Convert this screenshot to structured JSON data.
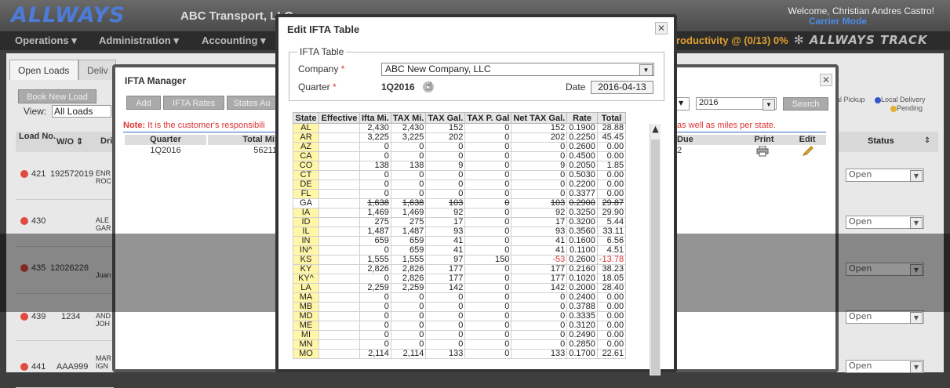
{
  "app": {
    "logo": "ALLWAYS",
    "company": "ABC Transport, LLC",
    "welcome": "Welcome, Christian Andres Castro!",
    "mode": "Carrier Mode",
    "menu": [
      "Operations",
      "Administration",
      "Accounting"
    ],
    "productivity": "roductivity @ (0/13) 0%",
    "track_logo": "ALLWAYS TRACK"
  },
  "background": {
    "tabs": [
      "Open Loads",
      "Deliv"
    ],
    "header": {
      "load_no": "Load No.",
      "wo": "W/O",
      "dr": "Dri",
      "status": "Status"
    },
    "rows": [
      {
        "load": "421",
        "wo": "192572019",
        "name": "ENR ROC",
        "status": "Open"
      },
      {
        "load": "430",
        "wo": "",
        "name": "ALE GAR",
        "status": "Open"
      },
      {
        "load": "435",
        "wo": "12026226",
        "name": "Juan",
        "status": "Open"
      },
      {
        "load": "439",
        "wo": "1234",
        "name": "AND JOH",
        "status": "Open"
      },
      {
        "load": "441",
        "wo": "AAA999",
        "name": "MAR IGN",
        "status": "Open"
      }
    ],
    "legend_pickup": "al Pickup",
    "legend_local": "Local Delivery",
    "legend_pending": "Pending"
  },
  "manager": {
    "title": "IFTA Manager",
    "buttons": {
      "add": "Add",
      "rates": "IFTA Rates",
      "states": "States Au"
    },
    "book_new_load": "Book New Load",
    "view_label": "View:",
    "view_value": "All Loads",
    "note_label": "Note:",
    "note_text": "It is the customer's responsibili",
    "note_suffix": "as well as miles per state.",
    "year": "2016",
    "search": "Search",
    "grid_headers": {
      "quarter": "Quarter",
      "total": "Total Mil",
      "due": "Due",
      "print": "Print",
      "edit": "Edit"
    },
    "grid_row": {
      "quarter": "1Q2016",
      "total": "56211",
      "due": "2"
    }
  },
  "edit_dialog": {
    "title": "Edit IFTA Table",
    "legend": "IFTA Table",
    "company_label": "Company",
    "company_value": "ABC New Company, LLC",
    "quarter_label": "Quarter",
    "quarter_value": "1Q2016",
    "date_label": "Date",
    "date_value": "2016-04-13",
    "columns": [
      "State",
      "Effective",
      "Ifta Mi.",
      "TAX Mi.",
      "TAX Gal.",
      "TAX P. Gal",
      "Net TAX Gal.",
      "Rate",
      "Total"
    ],
    "rows": [
      {
        "state": "AL",
        "eff": "",
        "ifta": "2,430",
        "tax_mi": "2,430",
        "tax_gal": "152",
        "tax_p": "0",
        "net": "152",
        "rate": "0.1900",
        "total": "28.88"
      },
      {
        "state": "AR",
        "eff": "",
        "ifta": "3,225",
        "tax_mi": "3,225",
        "tax_gal": "202",
        "tax_p": "0",
        "net": "202",
        "rate": "0.2250",
        "total": "45.45"
      },
      {
        "state": "AZ",
        "eff": "",
        "ifta": "0",
        "tax_mi": "0",
        "tax_gal": "0",
        "tax_p": "0",
        "net": "0",
        "rate": "0.2600",
        "total": "0.00"
      },
      {
        "state": "CA",
        "eff": "",
        "ifta": "0",
        "tax_mi": "0",
        "tax_gal": "0",
        "tax_p": "0",
        "net": "0",
        "rate": "0.4500",
        "total": "0.00"
      },
      {
        "state": "CO",
        "eff": "",
        "ifta": "138",
        "tax_mi": "138",
        "tax_gal": "9",
        "tax_p": "0",
        "net": "9",
        "rate": "0.2050",
        "total": "1.85"
      },
      {
        "state": "CT",
        "eff": "",
        "ifta": "0",
        "tax_mi": "0",
        "tax_gal": "0",
        "tax_p": "0",
        "net": "0",
        "rate": "0.5030",
        "total": "0.00"
      },
      {
        "state": "DE",
        "eff": "",
        "ifta": "0",
        "tax_mi": "0",
        "tax_gal": "0",
        "tax_p": "0",
        "net": "0",
        "rate": "0.2200",
        "total": "0.00"
      },
      {
        "state": "FL",
        "eff": "",
        "ifta": "0",
        "tax_mi": "0",
        "tax_gal": "0",
        "tax_p": "0",
        "net": "0",
        "rate": "0.3377",
        "total": "0.00"
      },
      {
        "state": "GA",
        "eff": "",
        "ifta": "1,638",
        "tax_mi": "1,638",
        "tax_gal": "103",
        "tax_p": "0",
        "net": "103",
        "rate": "0.2900",
        "total": "29.87",
        "strike": true
      },
      {
        "state": "IA",
        "eff": "",
        "ifta": "1,469",
        "tax_mi": "1,469",
        "tax_gal": "92",
        "tax_p": "0",
        "net": "92",
        "rate": "0.3250",
        "total": "29.90"
      },
      {
        "state": "ID",
        "eff": "",
        "ifta": "275",
        "tax_mi": "275",
        "tax_gal": "17",
        "tax_p": "0",
        "net": "17",
        "rate": "0.3200",
        "total": "5.44"
      },
      {
        "state": "IL",
        "eff": "",
        "ifta": "1,487",
        "tax_mi": "1,487",
        "tax_gal": "93",
        "tax_p": "0",
        "net": "93",
        "rate": "0.3560",
        "total": "33.11"
      },
      {
        "state": "IN",
        "eff": "",
        "ifta": "659",
        "tax_mi": "659",
        "tax_gal": "41",
        "tax_p": "0",
        "net": "41",
        "rate": "0.1600",
        "total": "6.56"
      },
      {
        "state": "IN^",
        "eff": "",
        "ifta": "0",
        "tax_mi": "659",
        "tax_gal": "41",
        "tax_p": "0",
        "net": "41",
        "rate": "0.1100",
        "total": "4.51"
      },
      {
        "state": "KS",
        "eff": "",
        "ifta": "1,555",
        "tax_mi": "1,555",
        "tax_gal": "97",
        "tax_p": "150",
        "net": "-53",
        "rate": "0.2600",
        "total": "-13.78",
        "neg": true
      },
      {
        "state": "KY",
        "eff": "",
        "ifta": "2,826",
        "tax_mi": "2,826",
        "tax_gal": "177",
        "tax_p": "0",
        "net": "177",
        "rate": "0.2160",
        "total": "38.23"
      },
      {
        "state": "KY^",
        "eff": "",
        "ifta": "0",
        "tax_mi": "2,826",
        "tax_gal": "177",
        "tax_p": "0",
        "net": "177",
        "rate": "0.1020",
        "total": "18.05"
      },
      {
        "state": "LA",
        "eff": "",
        "ifta": "2,259",
        "tax_mi": "2,259",
        "tax_gal": "142",
        "tax_p": "0",
        "net": "142",
        "rate": "0.2000",
        "total": "28.40"
      },
      {
        "state": "MA",
        "eff": "",
        "ifta": "0",
        "tax_mi": "0",
        "tax_gal": "0",
        "tax_p": "0",
        "net": "0",
        "rate": "0.2400",
        "total": "0.00"
      },
      {
        "state": "MB",
        "eff": "",
        "ifta": "0",
        "tax_mi": "0",
        "tax_gal": "0",
        "tax_p": "0",
        "net": "0",
        "rate": "0.3788",
        "total": "0.00"
      },
      {
        "state": "MD",
        "eff": "",
        "ifta": "0",
        "tax_mi": "0",
        "tax_gal": "0",
        "tax_p": "0",
        "net": "0",
        "rate": "0.3335",
        "total": "0.00"
      },
      {
        "state": "ME",
        "eff": "",
        "ifta": "0",
        "tax_mi": "0",
        "tax_gal": "0",
        "tax_p": "0",
        "net": "0",
        "rate": "0.3120",
        "total": "0.00"
      },
      {
        "state": "MI",
        "eff": "",
        "ifta": "0",
        "tax_mi": "0",
        "tax_gal": "0",
        "tax_p": "0",
        "net": "0",
        "rate": "0.2490",
        "total": "0.00"
      },
      {
        "state": "MN",
        "eff": "",
        "ifta": "0",
        "tax_mi": "0",
        "tax_gal": "0",
        "tax_p": "0",
        "net": "0",
        "rate": "0.2850",
        "total": "0.00"
      },
      {
        "state": "MO",
        "eff": "",
        "ifta": "2,114",
        "tax_mi": "2,114",
        "tax_gal": "133",
        "tax_p": "0",
        "net": "133",
        "rate": "0.1700",
        "total": "22.61"
      }
    ]
  }
}
